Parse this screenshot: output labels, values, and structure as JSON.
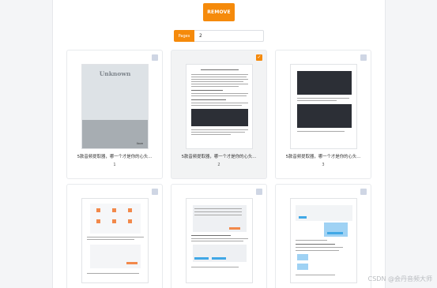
{
  "toolbar": {
    "remove_label": "REMOVE"
  },
  "pages": {
    "label": "Pages",
    "value": "2"
  },
  "colors": {
    "accent": "#f58a0b",
    "checkbox_off": "#cfd6e4"
  },
  "cards": [
    {
      "title": "5款音频提取器，哪一个才是你的心头...",
      "number": "1",
      "selected": false,
      "cover_title": "Unknown",
      "cover_publisher": "Ilove"
    },
    {
      "title": "5款音频提取器，哪一个才是你的心头...",
      "number": "2",
      "selected": true
    },
    {
      "title": "5款音频提取器，哪一个才是你的心头...",
      "number": "3",
      "selected": false
    },
    {
      "selected": false
    },
    {
      "selected": false
    },
    {
      "selected": false
    }
  ],
  "icons": {
    "checkbox": "checkbox-icon",
    "check": "checkmark-icon"
  },
  "watermark": "CSDN @会丹音频大师"
}
